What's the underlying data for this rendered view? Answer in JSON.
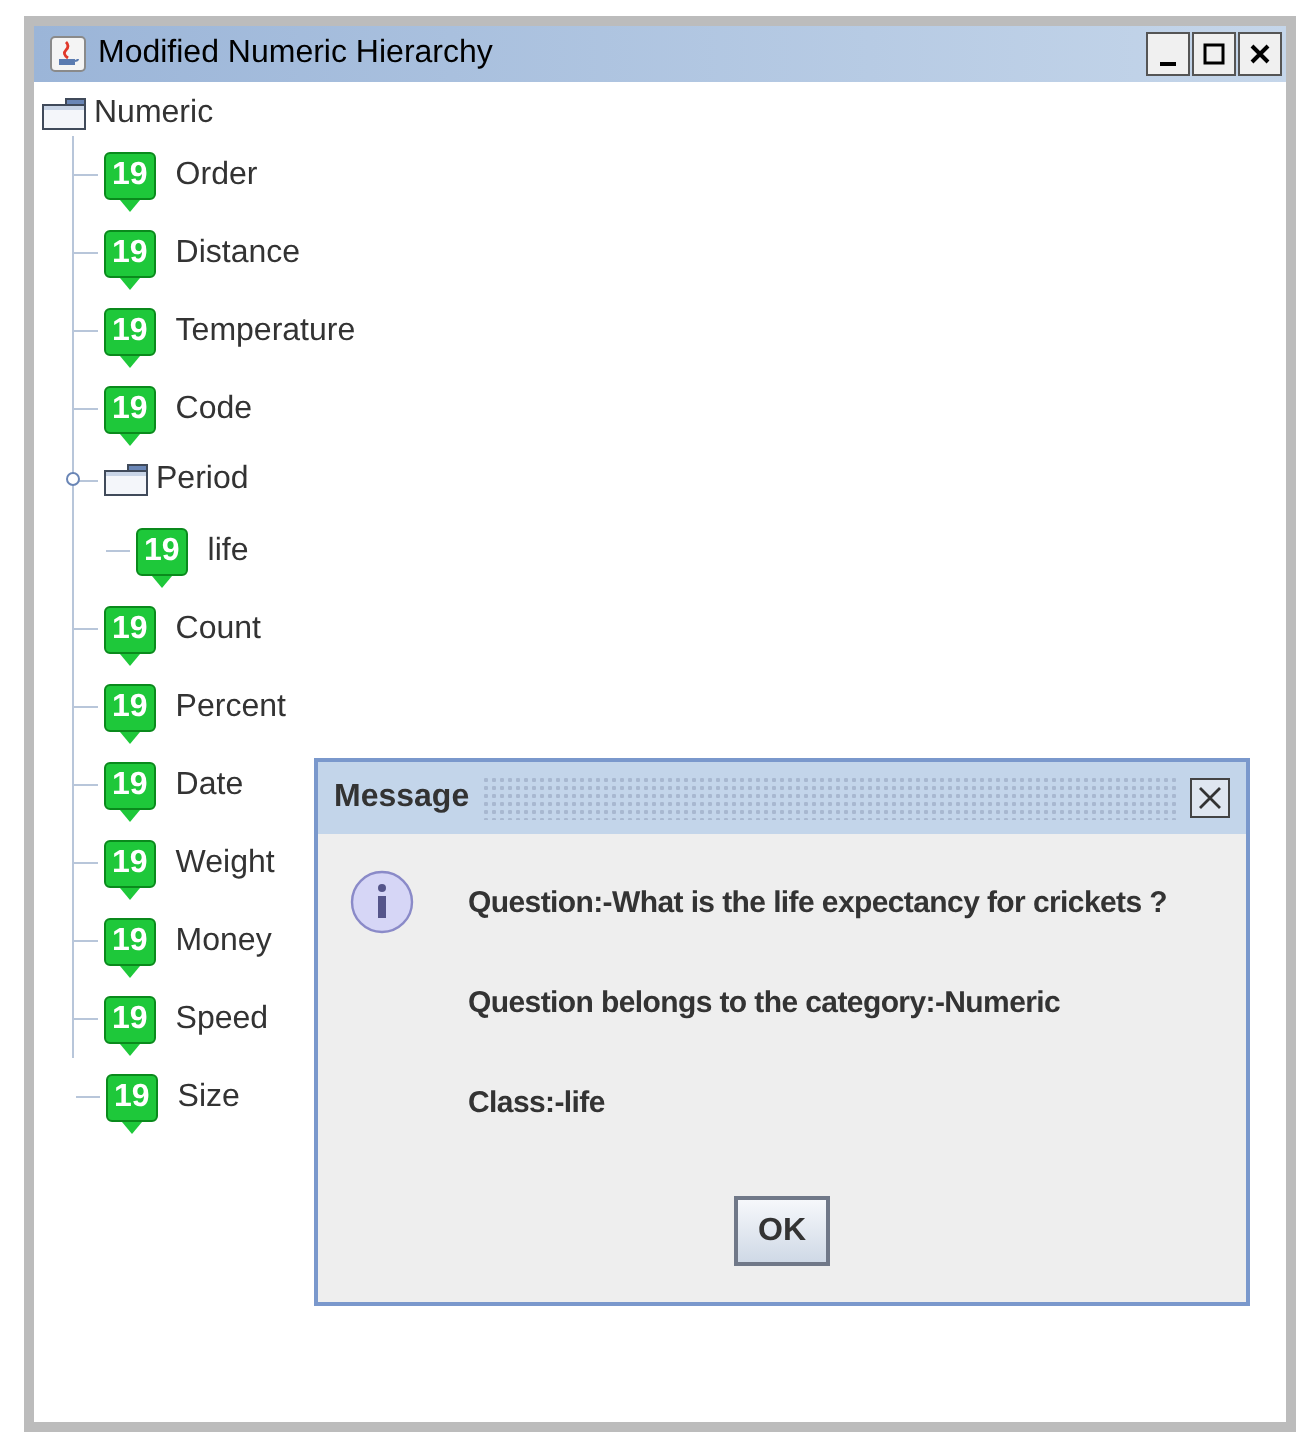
{
  "window": {
    "title": "Modified Numeric Hierarchy"
  },
  "tree": {
    "label": "Numeric",
    "kind": "folder",
    "children": [
      {
        "label": "Order",
        "kind": "leaf",
        "badge": "19"
      },
      {
        "label": "Distance",
        "kind": "leaf",
        "badge": "19"
      },
      {
        "label": "Temperature",
        "kind": "leaf",
        "badge": "19"
      },
      {
        "label": "Code",
        "kind": "leaf",
        "badge": "19"
      },
      {
        "label": "Period",
        "kind": "folder",
        "expanded": true,
        "children": [
          {
            "label": "life",
            "kind": "leaf",
            "badge": "19"
          }
        ]
      },
      {
        "label": "Count",
        "kind": "leaf",
        "badge": "19"
      },
      {
        "label": "Percent",
        "kind": "leaf",
        "badge": "19"
      },
      {
        "label": "Date",
        "kind": "leaf",
        "badge": "19"
      },
      {
        "label": "Weight",
        "kind": "leaf",
        "badge": "19"
      },
      {
        "label": "Money",
        "kind": "leaf",
        "badge": "19"
      },
      {
        "label": "Speed",
        "kind": "leaf",
        "badge": "19"
      },
      {
        "label": "Size",
        "kind": "leaf",
        "badge": "19"
      }
    ]
  },
  "dialog": {
    "title": "Message",
    "lines": [
      "Question:-What is the life expectancy for crickets ?",
      "Question belongs to the category:-Numeric",
      "Class:-life"
    ],
    "button": "OK"
  }
}
